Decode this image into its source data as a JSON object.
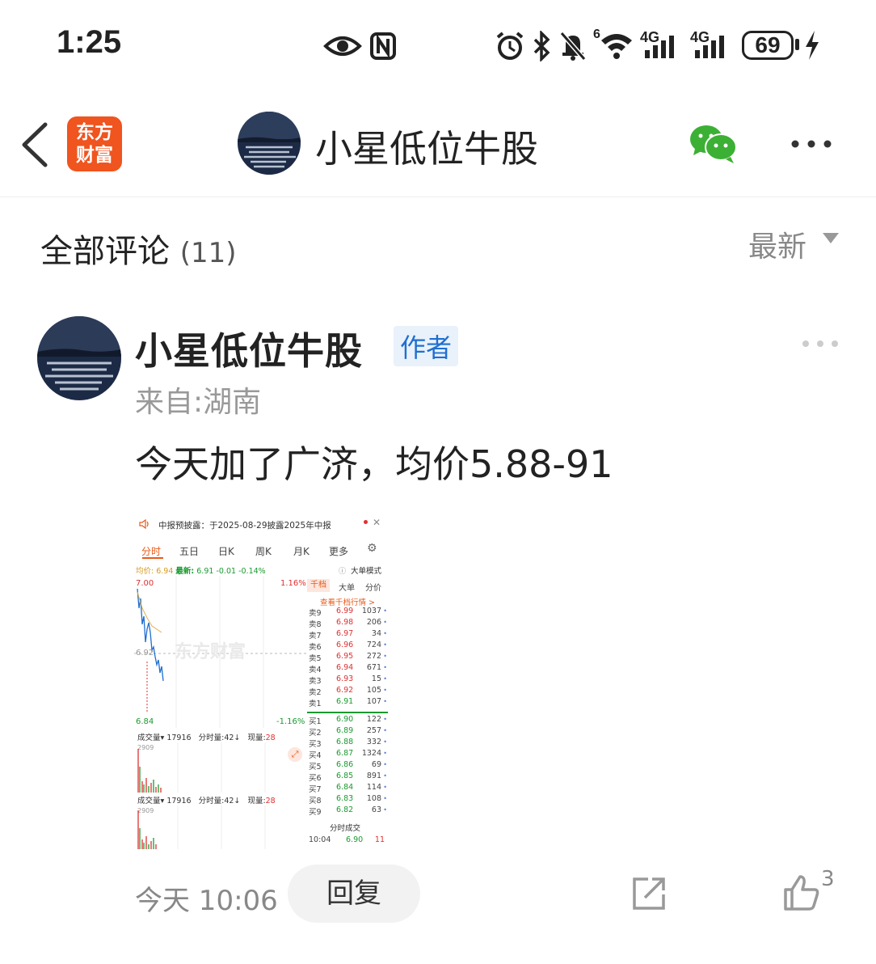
{
  "status_bar": {
    "time": "1:25",
    "network_small": "6",
    "g1": "4G",
    "g2": "4G",
    "battery": "69"
  },
  "header": {
    "logo_line1": "东方",
    "logo_line2": "财富",
    "title": "小星低位牛股"
  },
  "comments": {
    "title": "全部评论",
    "count": "(11)",
    "sort": "最新"
  },
  "post": {
    "author": "小星低位牛股",
    "badge": "作者",
    "origin": "来自:湖南",
    "content": "今天加了广济，均价5.88-91",
    "time": "今天 10:06",
    "reply": "回复",
    "likes": "3"
  },
  "image": {
    "notice": "中报预披露：于2025-08-29披露2025年中报",
    "tabs": [
      "分时",
      "五日",
      "日K",
      "周K",
      "月K",
      "更多"
    ],
    "price_line": {
      "avg_label": "均价:",
      "avg": "6.94",
      "latest_label": "最新:",
      "latest": "6.91",
      "chg": "-0.01",
      "pct": "-0.14%"
    },
    "mode": "大单模式",
    "high": "7.00",
    "high_pct": "1.16%",
    "mid": "6.92",
    "low": "6.84",
    "low_pct": "-1.16%",
    "watermark": "东方财富",
    "ob_tabs": [
      "千档",
      "大单",
      "分价"
    ],
    "ob_link": "查看千档行情 >",
    "sell": [
      {
        "label": "卖9",
        "price": "6.99",
        "vol": "1037"
      },
      {
        "label": "卖8",
        "price": "6.98",
        "vol": "206"
      },
      {
        "label": "卖7",
        "price": "6.97",
        "vol": "34"
      },
      {
        "label": "卖6",
        "price": "6.96",
        "vol": "724"
      },
      {
        "label": "卖5",
        "price": "6.95",
        "vol": "272"
      },
      {
        "label": "卖4",
        "price": "6.94",
        "vol": "671"
      },
      {
        "label": "卖3",
        "price": "6.93",
        "vol": "15"
      },
      {
        "label": "卖2",
        "price": "6.92",
        "vol": "105"
      },
      {
        "label": "卖1",
        "price": "6.91",
        "vol": "107"
      }
    ],
    "buy": [
      {
        "label": "买1",
        "price": "6.90",
        "vol": "122"
      },
      {
        "label": "买2",
        "price": "6.89",
        "vol": "257"
      },
      {
        "label": "买3",
        "price": "6.88",
        "vol": "332"
      },
      {
        "label": "买4",
        "price": "6.87",
        "vol": "1324"
      },
      {
        "label": "买5",
        "price": "6.86",
        "vol": "69"
      },
      {
        "label": "买6",
        "price": "6.85",
        "vol": "891"
      },
      {
        "label": "买7",
        "price": "6.84",
        "vol": "114"
      },
      {
        "label": "买8",
        "price": "6.83",
        "vol": "108"
      },
      {
        "label": "买9",
        "price": "6.82",
        "vol": "63"
      }
    ],
    "vol_bar": {
      "label": "成交量",
      "vol": "17916",
      "fsl_label": "分时量:",
      "fsl": "42",
      "now_label": "现量:",
      "now": "28",
      "max": "2909"
    },
    "fenshi_title": "分时成交",
    "trade": {
      "time": "10:04",
      "price": "6.90",
      "vol": "11"
    }
  }
}
